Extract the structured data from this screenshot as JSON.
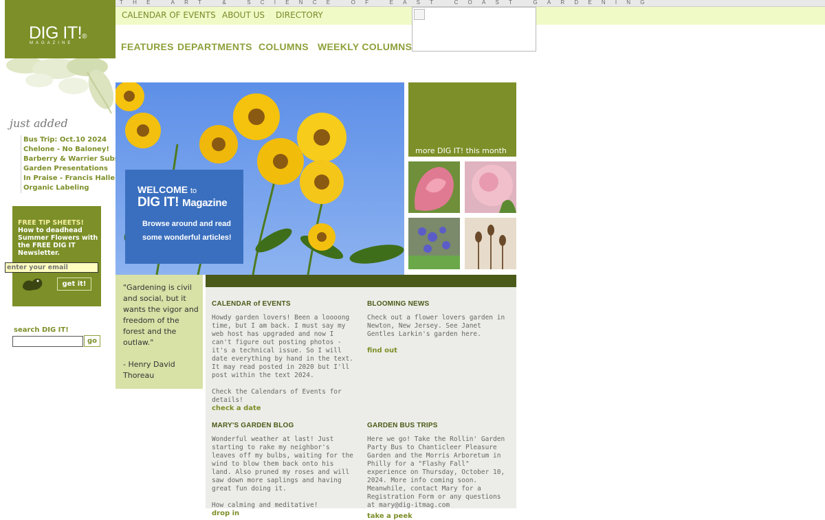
{
  "tagline": "THE ART & SCIENCE OF EAST COAST GARDENING",
  "logo": {
    "title": "DIG IT!",
    "registered": "®",
    "subtitle": "MAGAZINE"
  },
  "topnav": [
    "CALENDAR OF EVENTS",
    "ABOUT US",
    "DIRECTORY"
  ],
  "mainnav": [
    "FEATURES",
    "DEPARTMENTS",
    "COLUMNS",
    "WEEKLY COLUMNS"
  ],
  "just_added": {
    "heading": "just added",
    "items": [
      "Bus Trip: Oct.10 2024",
      "Chelone - No Baloney!",
      "Barberry & Warrier Subs",
      "Garden Presentations",
      "In Praise - Francis Halle",
      "Organic Labeling"
    ]
  },
  "tips": {
    "title": "FREE TIP SHEETS!",
    "body": "How to deadhead Summer Flowers with the FREE DIG IT Newsletter.",
    "email_placeholder": "enter your email",
    "button": "get it!"
  },
  "search": {
    "label": "search DIG IT!",
    "button": "go"
  },
  "welcome": {
    "line1": "WELCOME",
    "line1_small": "to",
    "line2": "DIG IT!",
    "line2_mag": "Magazine",
    "line3": "Browse around and read some wonderful articles!"
  },
  "more_box": "more DIG IT! this month",
  "quote": {
    "text": "\"Gardening is civil and social, but it wants the vigor and freedom of the forest and the outlaw.\"",
    "author": "- Henry David Thoreau"
  },
  "sections": [
    {
      "title": "CALENDAR of EVENTS",
      "body": "Howdy garden lovers! Been a loooong time, but I am back. I must say my web host has upgraded and now I can't figure out posting photos - it's a technical issue. So I will date everything by hand in the text. It may read posted in 2020 but I'll post within the text 2024.",
      "body2": "Check the Calendars of Events for details!",
      "link": "check a date"
    },
    {
      "title": "BLOOMING NEWS",
      "body": "Check out a flower lovers garden in Newton, New Jersey. See Janet Gentles Larkin's garden here.",
      "body2": "",
      "link": "find out"
    },
    {
      "title": "MARY'S GARDEN BLOG",
      "body": "Wonderful weather at last! Just starting to rake my neighbor's leaves off my bulbs, waiting for the wind to blow them back onto his land. Also pruned my roses and will saw down more saplings and having great fun doing it.",
      "body2": "How calming and meditative!",
      "link": "drop in"
    },
    {
      "title": "GARDEN BUS TRIPS",
      "body": "Here we go! Take the Rollin' Garden Party Bus to Chanticleer Pleasure Garden and the Morris Arboretum in Philly for a \"Flashy Fall\" experience on Thursday, October 10, 2024. More info coming soon. Meanwhile, contact Mary for a Registration Form or any questions at mary@dig-itmag.com",
      "body2": "",
      "link": "take a peek"
    }
  ],
  "colors": {
    "olive": "#7c8f28",
    "dark_olive": "#4a5a18",
    "light_yellow": "#f0fac6",
    "welcome_blue": "#3a6fbf",
    "quote_bg": "#d8e1a6"
  }
}
